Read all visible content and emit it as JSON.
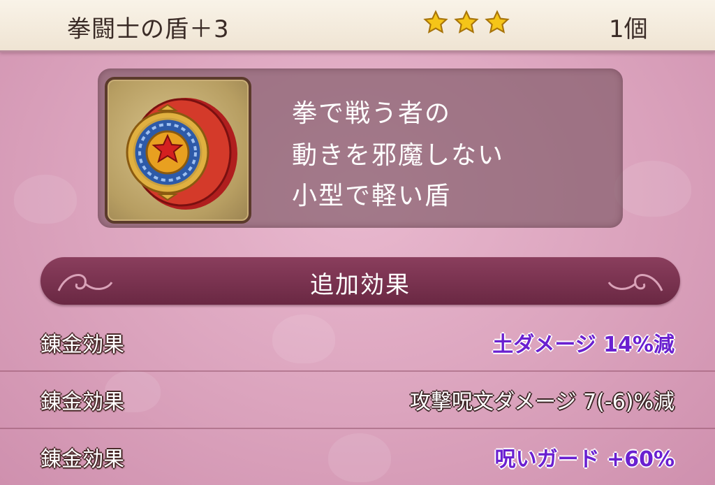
{
  "header": {
    "item_name": "拳闘士の盾＋3",
    "rarity_stars": 3,
    "quantity": "1個"
  },
  "item": {
    "icon": "shield-icon",
    "description_lines": [
      "拳で戦う者の",
      "動きを邪魔しない",
      "小型で軽い盾"
    ]
  },
  "section": {
    "title": "追加効果"
  },
  "effects": [
    {
      "label": "錬金効果",
      "value": "土ダメージ 14%減",
      "highlight": true
    },
    {
      "label": "錬金効果",
      "value": "攻撃呪文ダメージ 7(-6)%減",
      "highlight": false
    },
    {
      "label": "錬金効果",
      "value": "呪いガード +60%",
      "highlight": true
    }
  ],
  "colors": {
    "highlight_text": "#6a20d0",
    "section_bar": "#7a3050",
    "star": "#f5c518"
  }
}
